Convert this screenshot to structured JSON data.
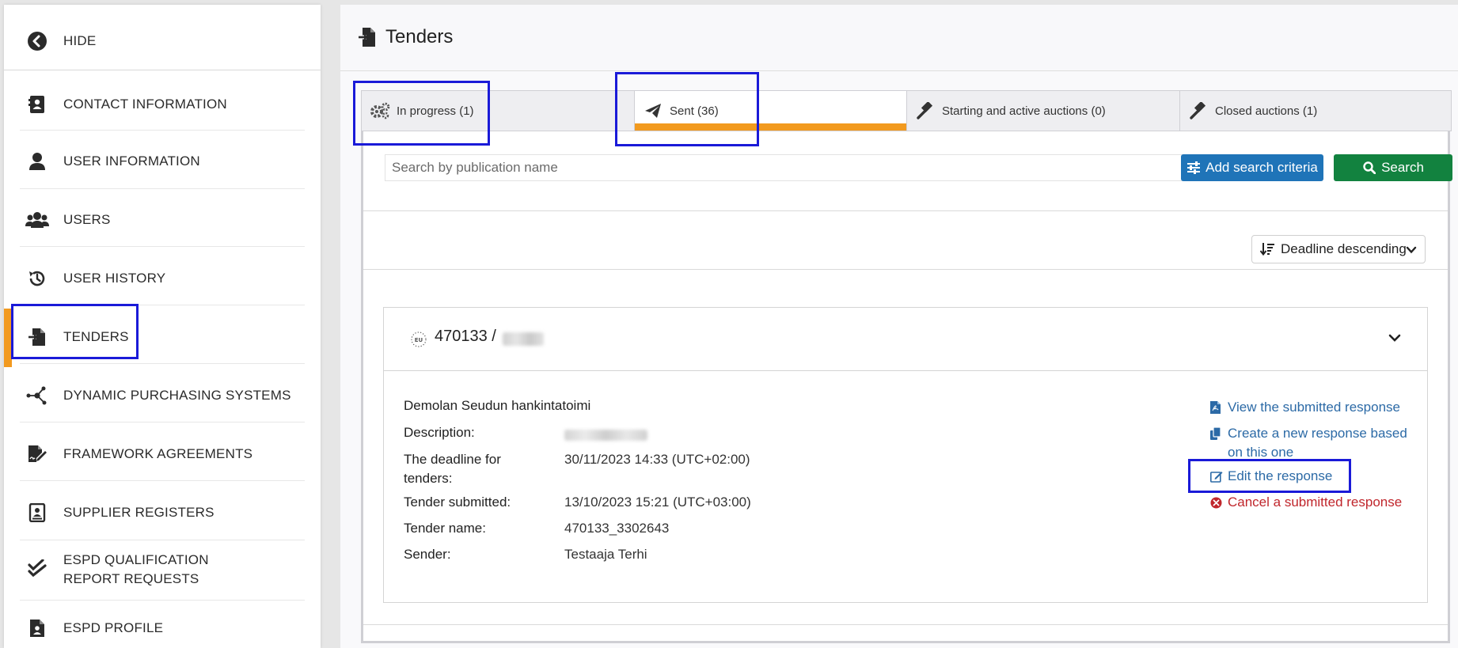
{
  "sidebar": {
    "items": [
      {
        "label": "HIDE",
        "icon": "back-circle-icon"
      },
      {
        "label": "CONTACT INFORMATION",
        "icon": "address-card-icon"
      },
      {
        "label": "USER INFORMATION",
        "icon": "user-icon"
      },
      {
        "label": "USERS",
        "icon": "users-icon"
      },
      {
        "label": "USER HISTORY",
        "icon": "history-icon"
      },
      {
        "label": "TENDERS",
        "icon": "file-import-icon",
        "active": true
      },
      {
        "label": "DYNAMIC PURCHASING SYSTEMS",
        "icon": "network-icon"
      },
      {
        "label": "FRAMEWORK AGREEMENTS",
        "icon": "file-signature-icon"
      },
      {
        "label": "SUPPLIER REGISTERS",
        "icon": "register-book-icon"
      },
      {
        "label": "ESPD QUALIFICATION REPORT REQUESTS",
        "icon": "check-double-icon"
      },
      {
        "label": "ESPD PROFILE",
        "icon": "file-user-icon"
      }
    ]
  },
  "header": {
    "title": "Tenders",
    "icon": "file-import-icon"
  },
  "tabs": [
    {
      "label": "In progress (1)",
      "icon": "gears-icon"
    },
    {
      "label": "Sent (36)",
      "icon": "paper-plane-icon",
      "active": true
    },
    {
      "label": "Starting and active auctions (0)",
      "icon": "gavel-icon"
    },
    {
      "label": "Closed auctions (1)",
      "icon": "gavel-icon"
    }
  ],
  "search": {
    "placeholder": "Search by publication name",
    "add_criteria_label": "Add search criteria",
    "search_label": "Search"
  },
  "sort": {
    "selected": "Deadline descending"
  },
  "tender": {
    "id": "470133 /",
    "organization": "Demolan Seudun hankintatoimi",
    "fields": {
      "description_label": "Description:",
      "deadline_label": "The deadline for tenders:",
      "deadline_value": "30/11/2023 14:33 (UTC+02:00)",
      "submitted_label": "Tender submitted:",
      "submitted_value": "13/10/2023 15:21 (UTC+03:00)",
      "name_label": "Tender name:",
      "name_value": "470133_3302643",
      "sender_label": "Sender:",
      "sender_value": "Testaaja Terhi"
    },
    "actions": {
      "view": "View the submitted response",
      "create": "Create a new response based on this one",
      "edit": "Edit the response",
      "cancel": "Cancel a submitted response"
    }
  },
  "colors": {
    "accent_orange": "#f29a1f",
    "link_blue": "#2c6aa6",
    "button_blue": "#1f74b8",
    "button_green": "#12823f",
    "danger_red": "#c0262c",
    "highlight_box": "#1a1ad8"
  }
}
